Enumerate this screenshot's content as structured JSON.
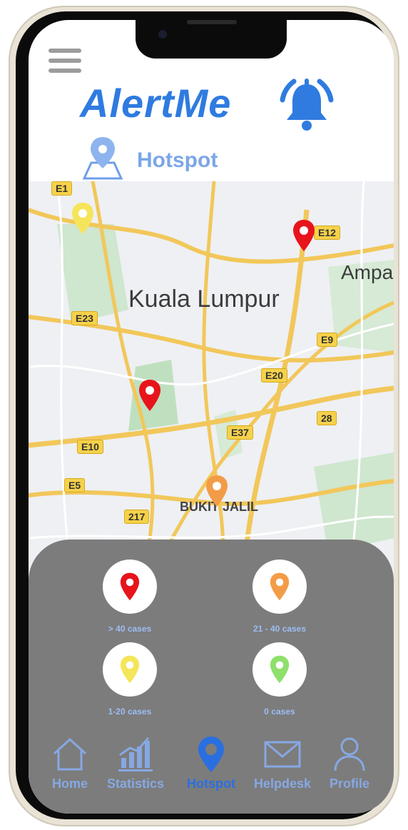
{
  "app": {
    "title": "AlertMe"
  },
  "header": {
    "menu_icon": "hamburger-menu-icon",
    "bell_icon": "alarm-bell-icon",
    "accent": "#2f7be0"
  },
  "section": {
    "title": "Hotspot",
    "icon": "map-pin-icon"
  },
  "map": {
    "city": "Kuala Lumpur",
    "area": "BUKIT JALIL",
    "partial_label": "Ampa",
    "shields": [
      "E1",
      "E12",
      "E23",
      "E9",
      "E20",
      "28",
      "E37",
      "E10",
      "E5",
      "217"
    ]
  },
  "legend": {
    "items": [
      {
        "label": "> 40 cases",
        "color": "#e8141b"
      },
      {
        "label": "21 - 40 cases",
        "color": "#f39c48"
      },
      {
        "label": "1-20 cases",
        "color": "#f5e55a"
      },
      {
        "label": "0 cases",
        "color": "#8ee06c"
      }
    ]
  },
  "nav": {
    "items": [
      {
        "label": "Home",
        "icon": "home-icon"
      },
      {
        "label": "Statistics",
        "icon": "bar-chart-icon"
      },
      {
        "label": "Hotspot",
        "icon": "map-pin-icon",
        "active": true
      },
      {
        "label": "Helpdesk",
        "icon": "envelope-icon"
      },
      {
        "label": "Profile",
        "icon": "user-icon"
      }
    ],
    "active_color": "#2a6fe0",
    "inactive_color": "#86a8e3"
  }
}
